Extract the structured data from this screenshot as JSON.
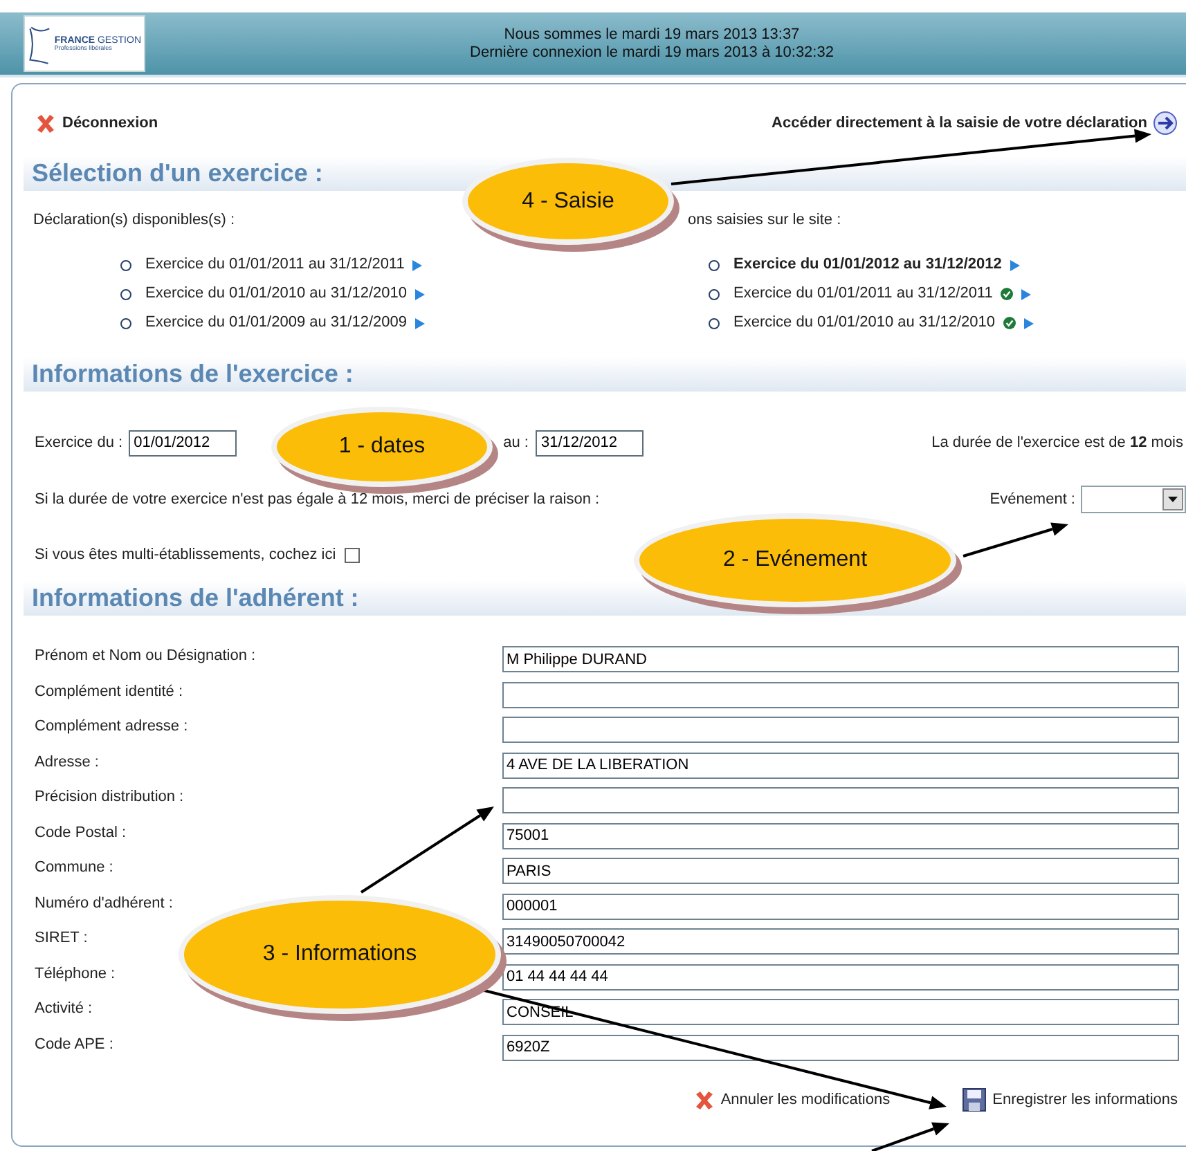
{
  "header": {
    "logo_name": "**FRANCE** GESTION",
    "logo_tagline": "Professions libérales",
    "date_line": "Nous sommes le mardi 19 mars 2013 13:37",
    "last_login": "Dernière connexion le mardi 19 mars 2013 à 10:32:32"
  },
  "toolbar": {
    "logout": "Déconnexion",
    "direct_link": "Accéder directement à la saisie de votre déclaration"
  },
  "selection": {
    "title": "Sélection d'un exercice :",
    "available": {
      "label": "Déclaration(s) disponibles(s) :",
      "items": [
        {
          "label": "Exercice du 01/01/2011 au 31/12/2011"
        },
        {
          "label": "Exercice du 01/01/2010 au 31/12/2010"
        },
        {
          "label": "Exercice du 01/01/2009 au 31/12/2009"
        }
      ]
    },
    "saved": {
      "label": "ons saisies sur le site :",
      "items": [
        {
          "label": "Exercice du 01/01/2012 au 31/12/2012",
          "selected": true,
          "validated": false
        },
        {
          "label": "Exercice du 01/01/2011 au 31/12/2011",
          "selected": false,
          "validated": true
        },
        {
          "label": "Exercice du 01/01/2010 au 31/12/2010",
          "selected": false,
          "validated": true
        }
      ]
    }
  },
  "exercice": {
    "title": "Informations de l'exercice :",
    "from_label": "Exercice du :",
    "from_value": "01/01/2012",
    "to_label": "au :",
    "to_value": "31/12/2012",
    "duration": "La durée de l'exercice est de **12** mois",
    "reason": "Si la durée de votre exercice n'est pas égale à 12 mois, merci de préciser la raison :",
    "event_label": "Evénement :",
    "multi_label": "Si vous êtes multi-établissements, cochez ici",
    "multi_checked": false
  },
  "adherent": {
    "title": "Informations de l'adhérent :",
    "fields": [
      {
        "label": "Prénom et Nom ou Désignation :",
        "value": "M Philippe DURAND"
      },
      {
        "label": "Complément identité :"
      },
      {
        "label": "Complément adresse :"
      },
      {
        "label": "Adresse :",
        "value": "4 AVE DE LA LIBERATION"
      },
      {
        "label": "Précision distribution :"
      },
      {
        "label": "Code Postal :",
        "value": "75001"
      },
      {
        "label": "Commune :",
        "value": "PARIS"
      },
      {
        "label": "Numéro d'adhérent :",
        "value": "000001"
      },
      {
        "label": "SIRET :",
        "value": "31490050700042"
      },
      {
        "label": "Téléphone :",
        "value": "01 44 44 44 44"
      },
      {
        "label": "Activité :",
        "value": "CONSEIL"
      },
      {
        "label": "Code APE :",
        "value": "6920Z"
      }
    ]
  },
  "actions": {
    "cancel": "Annuler les modifications",
    "save": "Enregistrer les informations"
  },
  "annotations": [
    {
      "label": "4 - Saisie"
    },
    {
      "label": "1 - dates"
    },
    {
      "label": "2 - Evénement"
    },
    {
      "label": "3 - Informations"
    }
  ]
}
